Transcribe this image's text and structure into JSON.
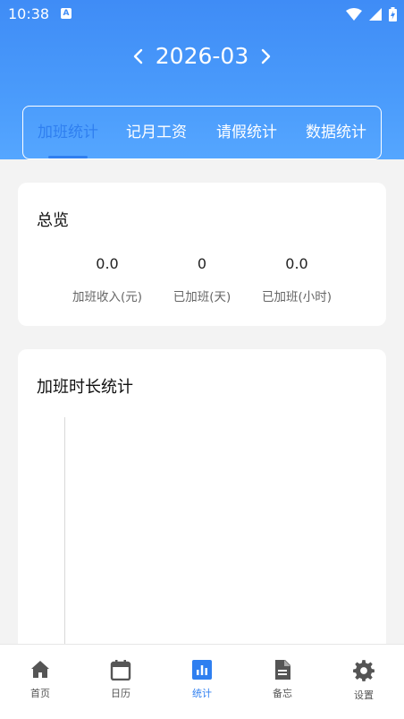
{
  "status_bar": {
    "time": "10:38",
    "icons": [
      "a-icon",
      "wifi-icon",
      "signal-icon",
      "battery-icon"
    ]
  },
  "month_nav": {
    "label": "2026-03",
    "prev_icon": "chevron-left-icon",
    "next_icon": "chevron-right-icon"
  },
  "tabs": [
    {
      "label": "加班统计",
      "active": true
    },
    {
      "label": "记月工资",
      "active": false
    },
    {
      "label": "请假统计",
      "active": false
    },
    {
      "label": "数据统计",
      "active": false
    }
  ],
  "overview": {
    "title": "总览",
    "stats": [
      {
        "value": "0.0",
        "label": "加班收入(元)"
      },
      {
        "value": "0",
        "label": "已加班(天)"
      },
      {
        "value": "0.0",
        "label": "已加班(小时)"
      }
    ]
  },
  "overtime_chart": {
    "title": "加班时长统计"
  },
  "bottom_nav": [
    {
      "label": "首页",
      "icon": "home-icon",
      "active": false
    },
    {
      "label": "日历",
      "icon": "calendar-icon",
      "active": false
    },
    {
      "label": "统计",
      "icon": "stats-icon",
      "active": true
    },
    {
      "label": "备忘",
      "icon": "memo-icon",
      "active": false
    },
    {
      "label": "设置",
      "icon": "gear-icon",
      "active": false
    }
  ],
  "colors": {
    "header_blue": "#4a9bfb",
    "accent": "#2f7ff0",
    "nav_inactive": "#555555"
  }
}
